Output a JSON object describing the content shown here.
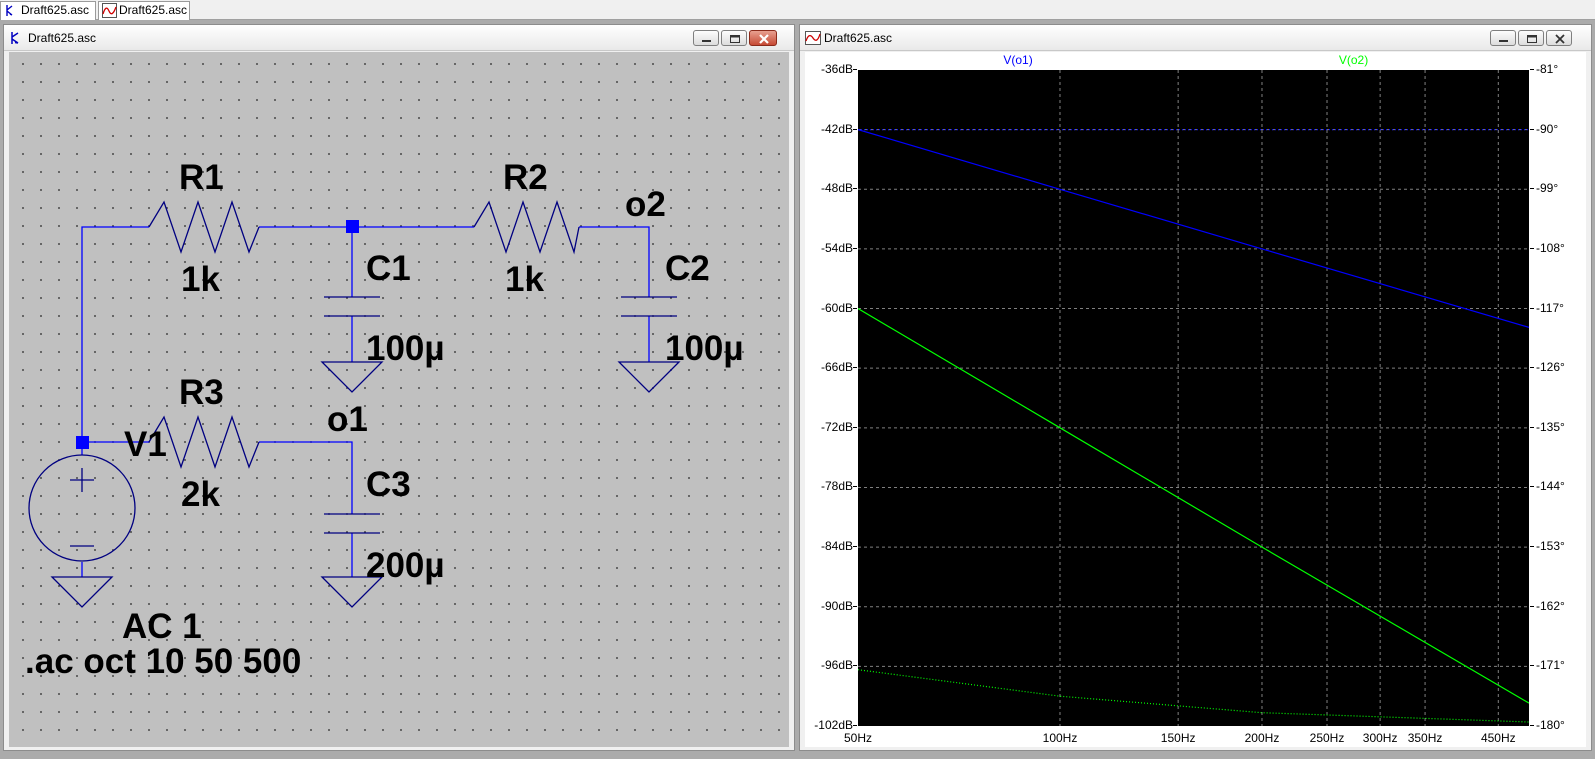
{
  "tabs": [
    {
      "label": "Draft625.asc",
      "icon": "schematic-icon"
    },
    {
      "label": "Draft625.asc",
      "icon": "waveform-icon"
    }
  ],
  "schematic_window": {
    "title": "Draft625.asc",
    "icon": "schematic-icon"
  },
  "plot_window": {
    "title": "Draft625.asc",
    "icon": "waveform-icon"
  },
  "schematic": {
    "components": {
      "R1": {
        "name": "R1",
        "value": "1k"
      },
      "R2": {
        "name": "R2",
        "value": "1k"
      },
      "R3": {
        "name": "R3",
        "value": "2k"
      },
      "C1": {
        "name": "C1",
        "value": "100µ"
      },
      "C2": {
        "name": "C2",
        "value": "100µ"
      },
      "C3": {
        "name": "C3",
        "value": "200µ"
      },
      "V1": {
        "name": "V1",
        "value": "AC 1"
      }
    },
    "nets": {
      "o1": "o1",
      "o2": "o2"
    },
    "directive": ".ac oct 10 50 500"
  },
  "colors": {
    "wire": "#0000ff",
    "component": "#000080",
    "v_o1": "#0000ff",
    "v_o2": "#00ff00",
    "grid": "#808080"
  },
  "chart_data": {
    "type": "line",
    "x_scale": "log",
    "xlim": [
      50,
      500
    ],
    "x_ticks": [
      50,
      100,
      150,
      200,
      250,
      300,
      350,
      450
    ],
    "x_tick_labels": [
      "50Hz",
      "100Hz",
      "150Hz",
      "200Hz",
      "250Hz",
      "300Hz",
      "350Hz",
      "450Hz"
    ],
    "ylim_left": [
      -102,
      -36
    ],
    "y_ticks_left": [
      -36,
      -42,
      -48,
      -54,
      -60,
      -66,
      -72,
      -78,
      -84,
      -90,
      -96,
      -102
    ],
    "y_tick_labels_left": [
      "-36dB",
      "-42dB",
      "-48dB",
      "-54dB",
      "-60dB",
      "-66dB",
      "-72dB",
      "-78dB",
      "-84dB",
      "-90dB",
      "-96dB",
      "-102dB"
    ],
    "ylim_right": [
      -180,
      -81
    ],
    "y_ticks_right": [
      -81,
      -90,
      -99,
      -108,
      -117,
      -126,
      -135,
      -144,
      -153,
      -162,
      -171,
      -180
    ],
    "y_tick_labels_right": [
      "-81°",
      "-90°",
      "-99°",
      "-108°",
      "-117°",
      "-126°",
      "-135°",
      "-144°",
      "-153°",
      "-162°",
      "-171°",
      "-180°"
    ],
    "grid": true,
    "series": [
      {
        "name": "V(o1)",
        "color": "#0000ff",
        "axis": "left",
        "style": "solid",
        "x": [
          50,
          100,
          200,
          500
        ],
        "y": [
          -42,
          -48,
          -54,
          -61.9
        ]
      },
      {
        "name": "",
        "color": "#0000ff",
        "axis": "right",
        "style": "dotted",
        "x": [
          50,
          500
        ],
        "y": [
          -90,
          -90
        ]
      },
      {
        "name": "V(o2)",
        "color": "#00ff00",
        "axis": "left",
        "style": "solid",
        "x": [
          50,
          100,
          200,
          500
        ],
        "y": [
          -60,
          -72,
          -84,
          -99.7
        ]
      },
      {
        "name": "",
        "color": "#00ff00",
        "axis": "right",
        "style": "dotted",
        "x": [
          50,
          100,
          200,
          500
        ],
        "y": [
          -171.5,
          -175.5,
          -178,
          -179.4
        ]
      }
    ]
  }
}
